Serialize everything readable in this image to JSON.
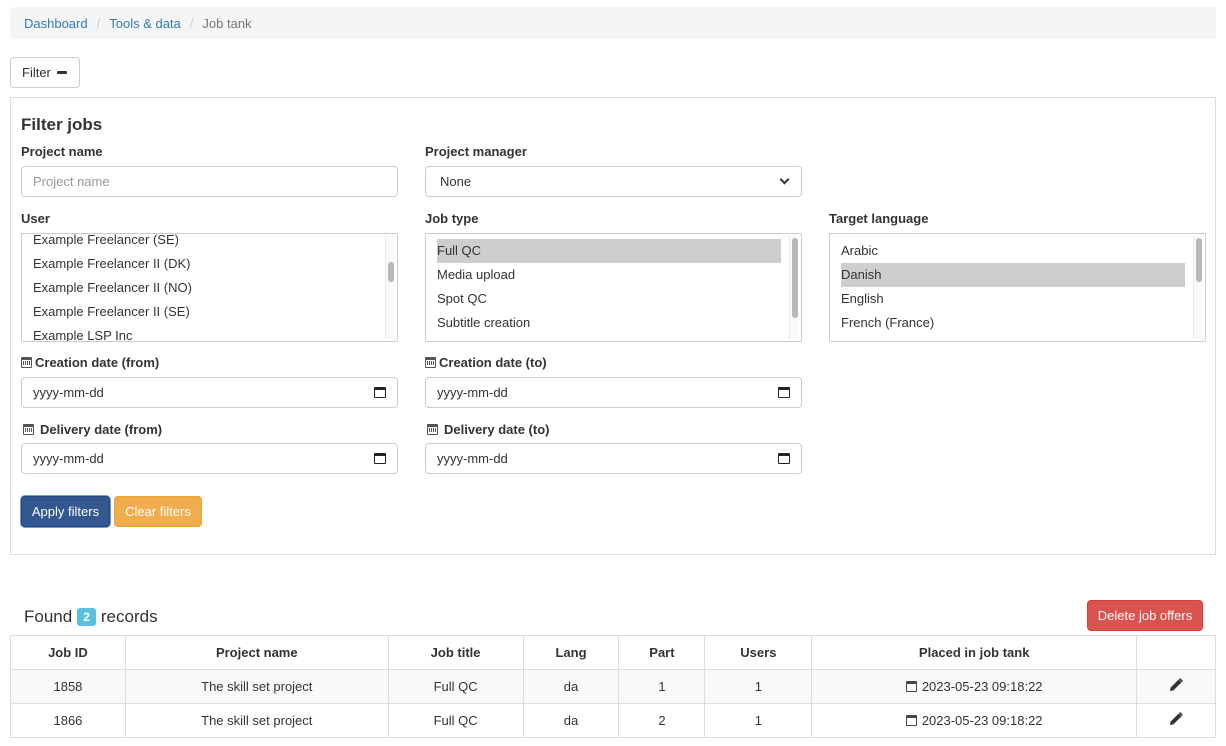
{
  "breadcrumb": {
    "items": [
      {
        "label": "Dashboard"
      },
      {
        "label": "Tools & data"
      },
      {
        "label": "Job tank"
      }
    ],
    "separator": "/"
  },
  "filter_toggle": {
    "label": "Filter",
    "icon": "minus-icon"
  },
  "filter_panel": {
    "title": "Filter jobs",
    "project_name": {
      "label": "Project name",
      "placeholder": "Project name",
      "value": ""
    },
    "project_manager": {
      "label": "Project manager",
      "selected": "None"
    },
    "user": {
      "label": "User",
      "options": [
        {
          "label": "Example Freelancer (SE)",
          "selected": false
        },
        {
          "label": "Example Freelancer II (DK)",
          "selected": false
        },
        {
          "label": "Example Freelancer II (NO)",
          "selected": false
        },
        {
          "label": "Example Freelancer II (SE)",
          "selected": false
        },
        {
          "label": "Example LSP Inc",
          "selected": false
        }
      ]
    },
    "job_type": {
      "label": "Job type",
      "options": [
        {
          "label": "Full QC",
          "selected": true
        },
        {
          "label": "Media upload",
          "selected": false
        },
        {
          "label": "Spot QC",
          "selected": false
        },
        {
          "label": "Subtitle creation",
          "selected": false
        }
      ]
    },
    "target_language": {
      "label": "Target language",
      "options": [
        {
          "label": "Arabic",
          "selected": false
        },
        {
          "label": "Danish",
          "selected": true
        },
        {
          "label": "English",
          "selected": false
        },
        {
          "label": "French (France)",
          "selected": false
        }
      ]
    },
    "creation_from": {
      "label": "Creation date (from)",
      "placeholder": "yyyy-mm-dd"
    },
    "creation_to": {
      "label": "Creation date (to)",
      "placeholder": "yyyy-mm-dd"
    },
    "delivery_from": {
      "label": "Delivery date (from)",
      "placeholder": "yyyy-mm-dd"
    },
    "delivery_to": {
      "label": "Delivery date (to)",
      "placeholder": "yyyy-mm-dd"
    },
    "apply_label": "Apply filters",
    "clear_label": "Clear filters"
  },
  "results": {
    "found_prefix": "Found",
    "count": "2",
    "found_suffix": "records",
    "delete_label": "Delete job offers",
    "columns": [
      "Job ID",
      "Project name",
      "Job title",
      "Lang",
      "Part",
      "Users",
      "Placed in job tank",
      ""
    ],
    "rows": [
      {
        "job_id": "1858",
        "project": "The skill set project",
        "title": "Full QC",
        "lang": "da",
        "part": "1",
        "users": "1",
        "placed": "2023-05-23 09:18:22"
      },
      {
        "job_id": "1866",
        "project": "The skill set project",
        "title": "Full QC",
        "lang": "da",
        "part": "2",
        "users": "1",
        "placed": "2023-05-23 09:18:22"
      }
    ]
  },
  "colors": {
    "link": "#337ab7",
    "primary": "#33578f",
    "warning": "#f0ad4e",
    "danger": "#d9534f",
    "info": "#5bc0de"
  }
}
